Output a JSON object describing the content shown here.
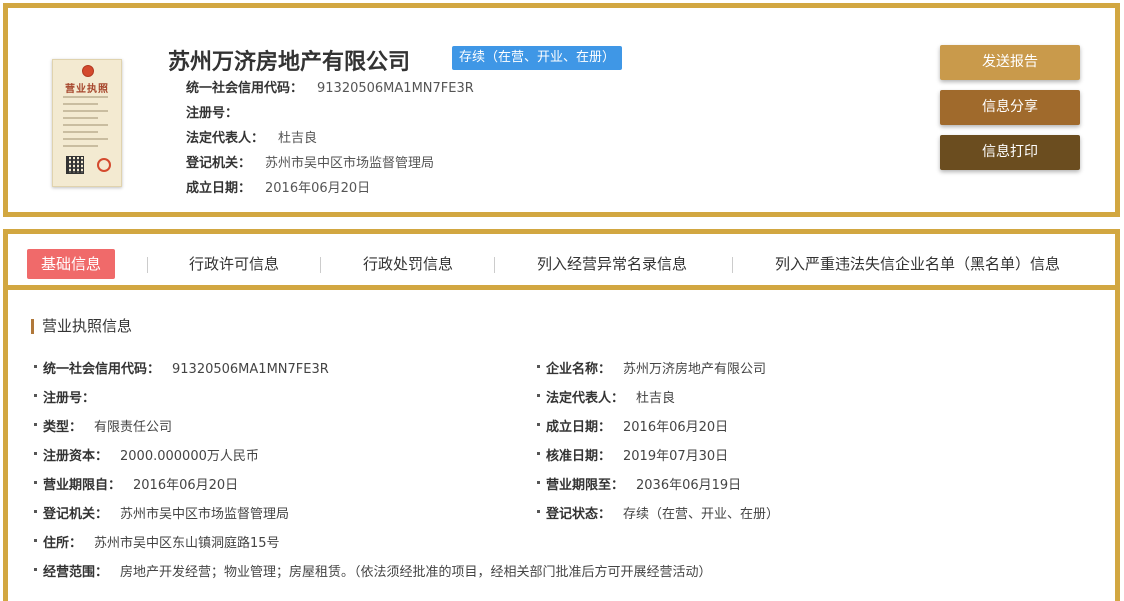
{
  "header": {
    "company_name": "苏州万济房地产有限公司",
    "status_tag": "存续（在营、开业、在册）",
    "license_image_title": "营业执照",
    "rows": [
      {
        "label": "统一社会信用代码：",
        "value": "91320506MA1MN7FE3R"
      },
      {
        "label": "注册号：",
        "value": ""
      },
      {
        "label": "法定代表人：",
        "value": "杜吉良"
      },
      {
        "label": "登记机关：",
        "value": "苏州市吴中区市场监督管理局"
      },
      {
        "label": "成立日期：",
        "value": "2016年06月20日"
      }
    ],
    "buttons": {
      "send_report": "发送报告",
      "share": "信息分享",
      "print": "信息打印"
    }
  },
  "tabs": [
    {
      "label": "基础信息",
      "active": true
    },
    {
      "label": "行政许可信息",
      "active": false
    },
    {
      "label": "行政处罚信息",
      "active": false
    },
    {
      "label": "列入经营异常名录信息",
      "active": false
    },
    {
      "label": "列入严重违法失信企业名单（黑名单）信息",
      "active": false
    }
  ],
  "section": {
    "title": "营业执照信息",
    "fields": [
      {
        "label": "统一社会信用代码：",
        "value": "91320506MA1MN7FE3R"
      },
      {
        "label": "企业名称：",
        "value": "苏州万济房地产有限公司"
      },
      {
        "label": "注册号：",
        "value": ""
      },
      {
        "label": "法定代表人：",
        "value": "杜吉良"
      },
      {
        "label": "类型：",
        "value": "有限责任公司"
      },
      {
        "label": "成立日期：",
        "value": "2016年06月20日"
      },
      {
        "label": "注册资本：",
        "value": "2000.000000万人民币"
      },
      {
        "label": "核准日期：",
        "value": "2019年07月30日"
      },
      {
        "label": "营业期限自：",
        "value": "2016年06月20日"
      },
      {
        "label": "营业期限至：",
        "value": "2036年06月19日"
      },
      {
        "label": "登记机关：",
        "value": "苏州市吴中区市场监督管理局"
      },
      {
        "label": "登记状态：",
        "value": "存续（在营、开业、在册）"
      },
      {
        "label": "住所：",
        "value": "苏州市吴中区东山镇洞庭路15号"
      },
      {
        "label": "经营范围：",
        "value": "房地产开发经营；物业管理；房屋租赁。（依法须经批准的项目，经相关部门批准后方可开展经营活动）"
      }
    ]
  },
  "colors": {
    "border_gold": "#d2a741",
    "status_blue": "#3f97e6",
    "active_tab_red": "#f06a6a",
    "btn_send": "#c99a4b",
    "btn_share": "#a06a2c",
    "btn_print": "#6b4d1f"
  }
}
